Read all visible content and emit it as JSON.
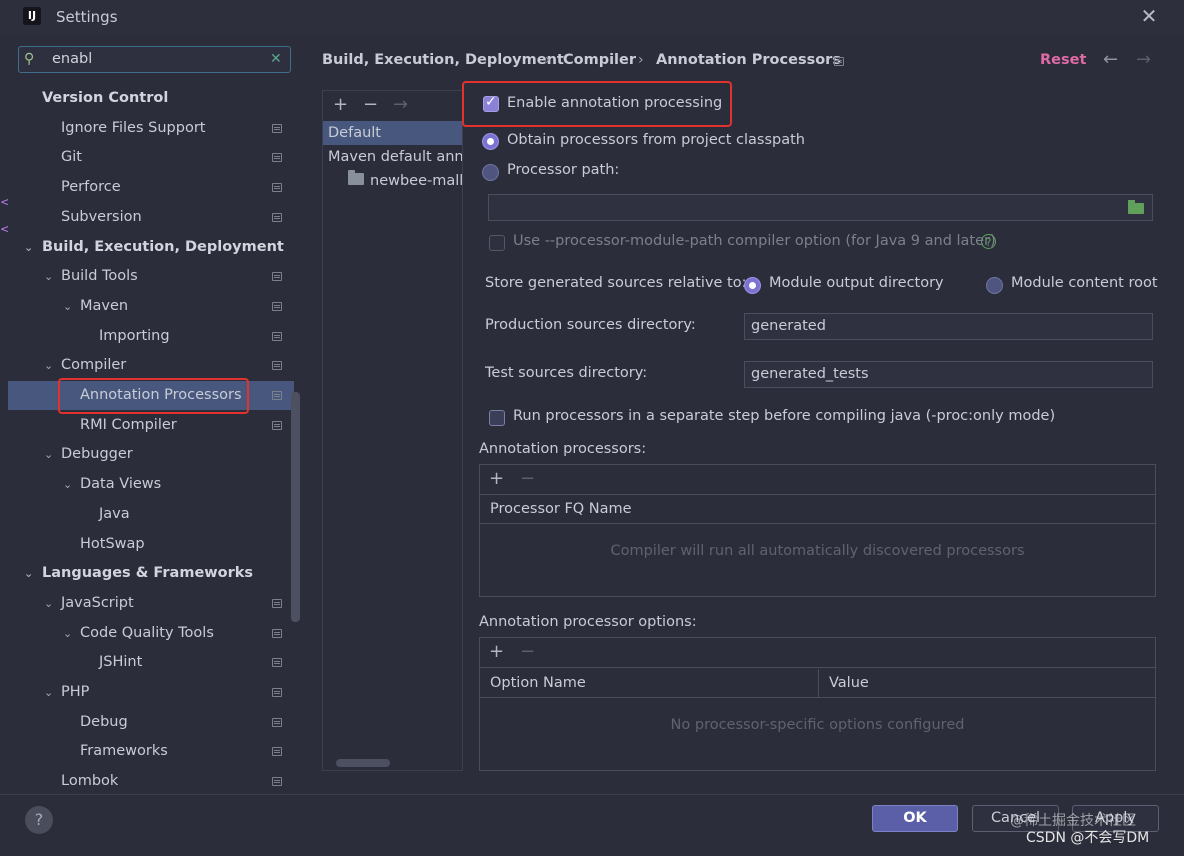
{
  "window": {
    "title": "Settings",
    "app_icon_letter": "IJ"
  },
  "search": {
    "value": "enabl"
  },
  "tree": [
    {
      "label": "Version Control",
      "bold": true,
      "indent": 0,
      "chevron": "",
      "proj": false
    },
    {
      "label": "Ignore Files Support",
      "indent": 1,
      "chevron": "",
      "proj": true
    },
    {
      "label": "Git",
      "indent": 1,
      "chevron": "",
      "proj": true
    },
    {
      "label": "Perforce",
      "indent": 1,
      "chevron": "",
      "proj": true
    },
    {
      "label": "Subversion",
      "indent": 1,
      "chevron": "",
      "proj": true
    },
    {
      "label": "Build, Execution, Deployment",
      "bold": true,
      "indent": 0,
      "chevron": "open",
      "proj": false
    },
    {
      "label": "Build Tools",
      "indent": 1,
      "chevron": "open",
      "proj": true
    },
    {
      "label": "Maven",
      "indent": 2,
      "chevron": "open",
      "proj": true
    },
    {
      "label": "Importing",
      "indent": 3,
      "chevron": "",
      "proj": true
    },
    {
      "label": "Compiler",
      "indent": 1,
      "chevron": "open",
      "proj": true
    },
    {
      "label": "Annotation Processors",
      "indent": 2,
      "chevron": "",
      "proj": true,
      "selected": true
    },
    {
      "label": "RMI Compiler",
      "indent": 2,
      "chevron": "",
      "proj": true
    },
    {
      "label": "Debugger",
      "indent": 1,
      "chevron": "open",
      "proj": false
    },
    {
      "label": "Data Views",
      "indent": 2,
      "chevron": "open",
      "proj": false
    },
    {
      "label": "Java",
      "indent": 3,
      "chevron": "",
      "proj": false
    },
    {
      "label": "HotSwap",
      "indent": 2,
      "chevron": "",
      "proj": false
    },
    {
      "label": "Languages & Frameworks",
      "bold": true,
      "indent": 0,
      "chevron": "open",
      "proj": false
    },
    {
      "label": "JavaScript",
      "indent": 1,
      "chevron": "open",
      "proj": true
    },
    {
      "label": "Code Quality Tools",
      "indent": 2,
      "chevron": "open",
      "proj": true
    },
    {
      "label": "JSHint",
      "indent": 3,
      "chevron": "",
      "proj": true
    },
    {
      "label": "PHP",
      "indent": 1,
      "chevron": "open",
      "proj": true
    },
    {
      "label": "Debug",
      "indent": 2,
      "chevron": "",
      "proj": true
    },
    {
      "label": "Frameworks",
      "indent": 2,
      "chevron": "",
      "proj": true
    },
    {
      "label": "Lombok",
      "indent": 1,
      "chevron": "",
      "proj": true
    }
  ],
  "breadcrumb": [
    "Build, Execution, Deployment",
    "Compiler",
    "Annotation Processors"
  ],
  "header": {
    "reset": "Reset"
  },
  "profiles": {
    "items": [
      "Default",
      "Maven default annotation processors profile",
      "newbee-mall-api"
    ]
  },
  "settings": {
    "enable_annotation": "Enable annotation processing",
    "enable_checked": true,
    "obtain_classpath": "Obtain processors from project classpath",
    "processor_path": "Processor path:",
    "processor_path_value": "",
    "module_path_option": "Use --processor-module-path compiler option (for Java 9 and later)",
    "store_label": "Store generated sources relative to:",
    "module_output": "Module output directory",
    "module_content": "Module content root",
    "production_label": "Production sources directory:",
    "production_value": "generated",
    "test_label": "Test sources directory:",
    "test_value": "generated_tests",
    "separate_step": "Run processors in a separate step before compiling java (-proc:only mode)"
  },
  "annotation_processors": {
    "title": "Annotation processors:",
    "column": "Processor FQ Name",
    "empty": "Compiler will run all automatically discovered processors"
  },
  "processor_options": {
    "title": "Annotation processor options:",
    "columns": [
      "Option Name",
      "Value"
    ],
    "empty": "No processor-specific options configured"
  },
  "buttons": {
    "ok": "OK",
    "cancel": "Cancel",
    "apply": "Apply",
    "help": "?"
  },
  "watermark": {
    "line1": "@稀土掘金技术社区",
    "line2": "CSDN @不会写DM"
  },
  "icons": {
    "close": "close-icon",
    "search": "search-icon",
    "clear": "clear-icon",
    "add": "+",
    "remove": "−",
    "move": "→",
    "back": "←",
    "forward": "→",
    "settings_scope": "project-scope-icon",
    "folder": "folder-icon"
  },
  "colors": {
    "accent": "#7b73d2",
    "selection": "#47577e",
    "highlight_box": "#e1322e",
    "reset": "#e06aa6"
  }
}
